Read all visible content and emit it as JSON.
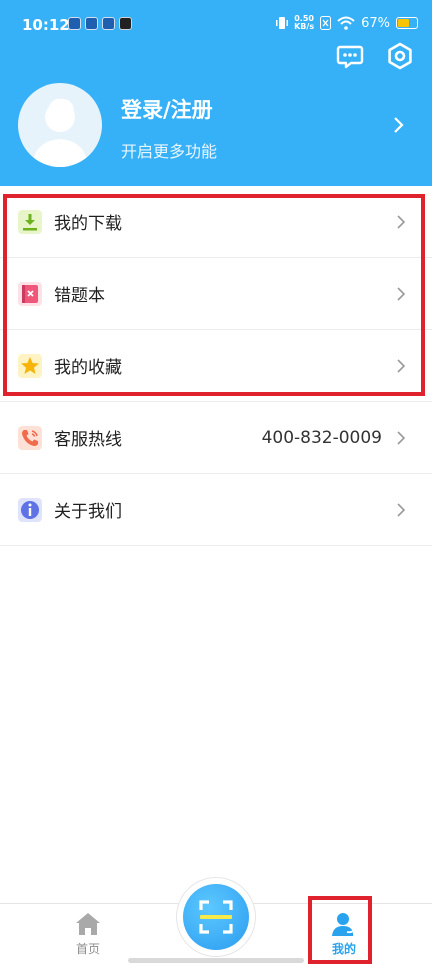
{
  "status_bar": {
    "time": "10:12",
    "net_speed_value": "0.50",
    "net_speed_unit": "KB/s",
    "battery_text": "67%",
    "battery_level": 0.67
  },
  "header": {
    "title": "登录/注册",
    "subtitle": "开启更多功能",
    "background_color": "#36b1f7"
  },
  "menu": {
    "downloads": {
      "label": "我的下载",
      "icon": "download-icon"
    },
    "mistakes": {
      "label": "错题本",
      "icon": "error-book-icon"
    },
    "favorites": {
      "label": "我的收藏",
      "icon": "star-icon"
    },
    "hotline": {
      "label": "客服热线",
      "value": "400-832-0009",
      "icon": "phone-icon"
    },
    "about": {
      "label": "关于我们",
      "icon": "info-icon"
    }
  },
  "tabs": {
    "home": {
      "label": "首页",
      "icon": "home-icon"
    },
    "scan": {
      "icon": "scan-icon"
    },
    "mine": {
      "label": "我的",
      "icon": "user-icon",
      "active": true
    }
  },
  "colors": {
    "accent": "#2aa3ee",
    "highlight_frame": "#e0222e"
  }
}
